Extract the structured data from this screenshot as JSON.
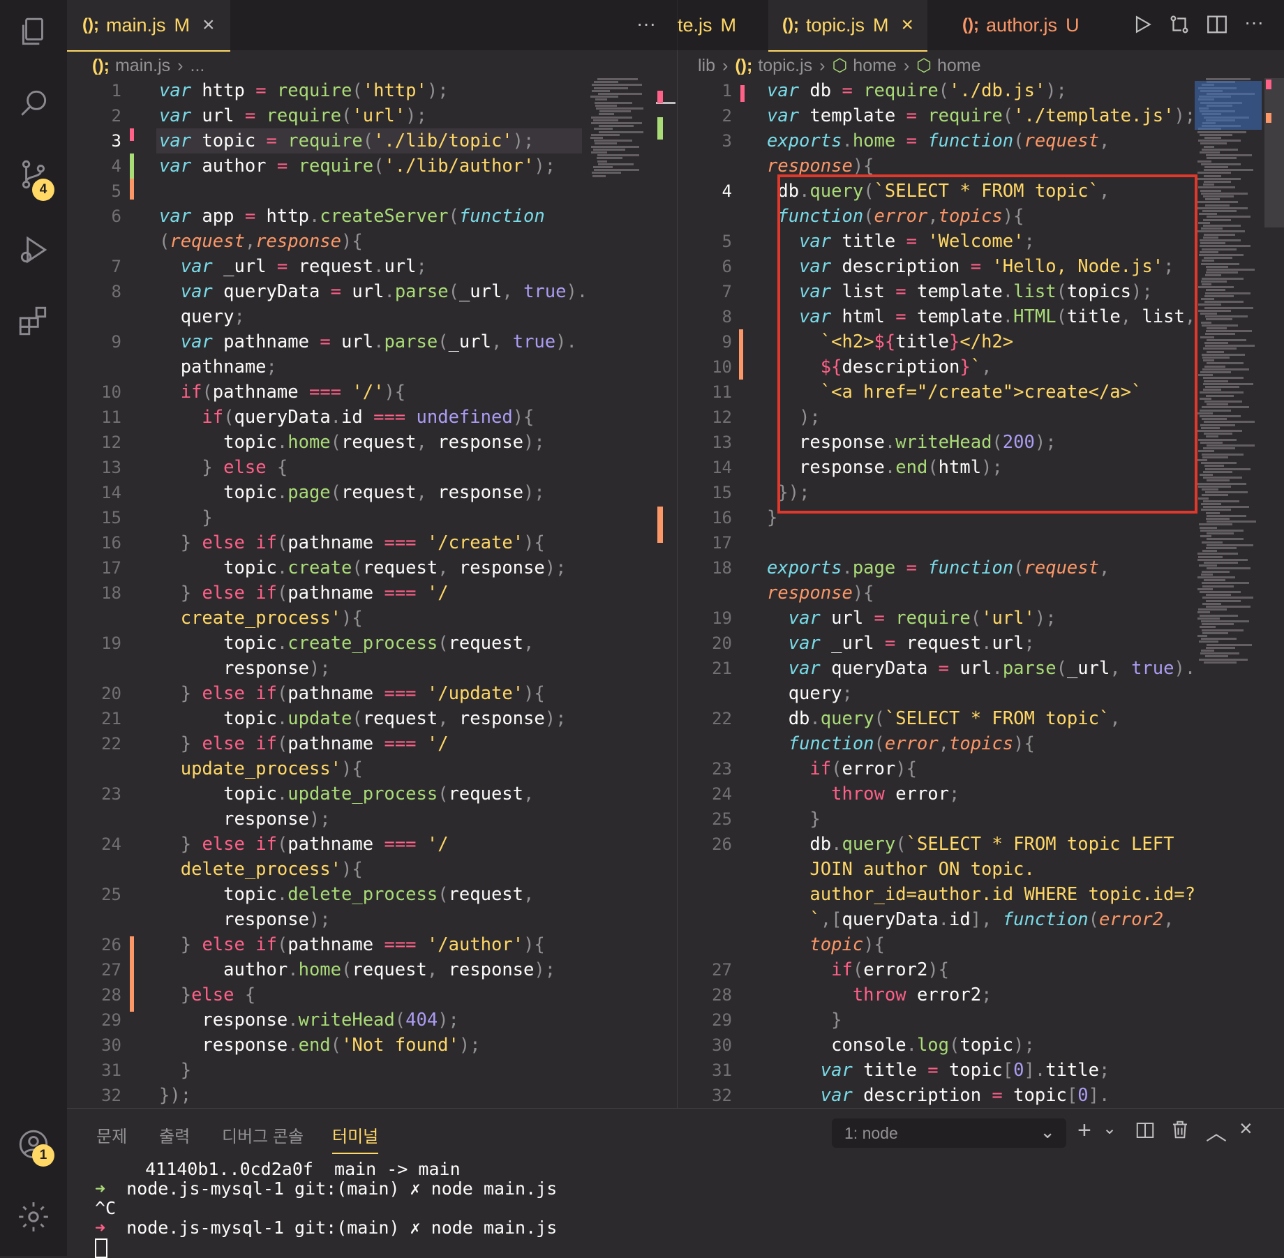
{
  "left_editor": {
    "tab": {
      "label": "main.js",
      "status": "M",
      "icon": "(); "
    },
    "breadcrumb": [
      "main.js",
      "..."
    ],
    "lines": [
      {
        "n": "1",
        "html": "<span class='k'>var</span> http <span class='kw'>=</span> <span class='fn'>require</span><span class='p'>(</span><span class='s'>'http'</span><span class='p'>);</span>"
      },
      {
        "n": "2",
        "html": "<span class='k'>var</span> url <span class='kw'>=</span> <span class='fn'>require</span><span class='p'>(</span><span class='s'>'url'</span><span class='p'>);</span>"
      },
      {
        "n": "3",
        "html": "<span class='k'>var</span> topic <span class='kw'>=</span> <span class='fn'>require</span><span class='p'>(</span><span class='s'>'./lib/topic'</span><span class='p'>);</span>"
      },
      {
        "n": "4",
        "html": "<span class='k'>var</span> author <span class='kw'>=</span> <span class='fn'>require</span><span class='p'>(</span><span class='s'>'./lib/author'</span><span class='p'>);</span>"
      },
      {
        "n": "5",
        "html": ""
      },
      {
        "n": "6",
        "html": "<span class='k'>var</span> app <span class='kw'>=</span> http<span class='p'>.</span><span class='fn'>createServer</span><span class='p'>(</span><span class='k'>function</span>"
      },
      {
        "n": "",
        "html": "<span class='p'>(</span><span class='prm'>request</span><span class='p'>,</span><span class='prm'>response</span><span class='p'>){</span>"
      },
      {
        "n": "7",
        "html": "  <span class='k'>var</span> _url <span class='kw'>=</span> request<span class='p'>.</span>url<span class='p'>;</span>"
      },
      {
        "n": "8",
        "html": "  <span class='k'>var</span> queryData <span class='kw'>=</span> url<span class='p'>.</span><span class='fn'>parse</span><span class='p'>(</span>_url<span class='p'>,</span> <span class='nm'>true</span><span class='p'>).</span>"
      },
      {
        "n": "",
        "html": "  query<span class='p'>;</span>"
      },
      {
        "n": "9",
        "html": "  <span class='k'>var</span> pathname <span class='kw'>=</span> url<span class='p'>.</span><span class='fn'>parse</span><span class='p'>(</span>_url<span class='p'>,</span> <span class='nm'>true</span><span class='p'>).</span>"
      },
      {
        "n": "",
        "html": "  pathname<span class='p'>;</span>"
      },
      {
        "n": "10",
        "html": "  <span class='kw'>if</span><span class='p'>(</span>pathname <span class='kw'>===</span> <span class='s'>'/'</span><span class='p'>){</span>"
      },
      {
        "n": "11",
        "html": "    <span class='kw'>if</span><span class='p'>(</span>queryData<span class='p'>.</span>id <span class='kw'>===</span> <span class='nm'>undefined</span><span class='p'>){</span>"
      },
      {
        "n": "12",
        "html": "      topic<span class='p'>.</span><span class='fn'>home</span><span class='p'>(</span>request<span class='p'>,</span> response<span class='p'>);</span>"
      },
      {
        "n": "13",
        "html": "    <span class='p'>}</span> <span class='kw'>else</span> <span class='p'>{</span>"
      },
      {
        "n": "14",
        "html": "      topic<span class='p'>.</span><span class='fn'>page</span><span class='p'>(</span>request<span class='p'>,</span> response<span class='p'>);</span>"
      },
      {
        "n": "15",
        "html": "    <span class='p'>}</span>"
      },
      {
        "n": "16",
        "html": "  <span class='p'>}</span> <span class='kw'>else</span> <span class='kw'>if</span><span class='p'>(</span>pathname <span class='kw'>===</span> <span class='s'>'/create'</span><span class='p'>){</span>"
      },
      {
        "n": "17",
        "html": "      topic<span class='p'>.</span><span class='fn'>create</span><span class='p'>(</span>request<span class='p'>,</span> response<span class='p'>);</span>"
      },
      {
        "n": "18",
        "html": "  <span class='p'>}</span> <span class='kw'>else</span> <span class='kw'>if</span><span class='p'>(</span>pathname <span class='kw'>===</span> <span class='s'>'/</span>"
      },
      {
        "n": "",
        "html": "  <span class='s'>create_process'</span><span class='p'>){</span>"
      },
      {
        "n": "19",
        "html": "      topic<span class='p'>.</span><span class='fn'>create_process</span><span class='p'>(</span>request<span class='p'>,</span>"
      },
      {
        "n": "",
        "html": "      response<span class='p'>);</span>"
      },
      {
        "n": "20",
        "html": "  <span class='p'>}</span> <span class='kw'>else</span> <span class='kw'>if</span><span class='p'>(</span>pathname <span class='kw'>===</span> <span class='s'>'/update'</span><span class='p'>){</span>"
      },
      {
        "n": "21",
        "html": "      topic<span class='p'>.</span><span class='fn'>update</span><span class='p'>(</span>request<span class='p'>,</span> response<span class='p'>);</span>"
      },
      {
        "n": "22",
        "html": "  <span class='p'>}</span> <span class='kw'>else</span> <span class='kw'>if</span><span class='p'>(</span>pathname <span class='kw'>===</span> <span class='s'>'/</span>"
      },
      {
        "n": "",
        "html": "  <span class='s'>update_process'</span><span class='p'>){</span>"
      },
      {
        "n": "23",
        "html": "      topic<span class='p'>.</span><span class='fn'>update_process</span><span class='p'>(</span>request<span class='p'>,</span>"
      },
      {
        "n": "",
        "html": "      response<span class='p'>);</span>"
      },
      {
        "n": "24",
        "html": "  <span class='p'>}</span> <span class='kw'>else</span> <span class='kw'>if</span><span class='p'>(</span>pathname <span class='kw'>===</span> <span class='s'>'/</span>"
      },
      {
        "n": "",
        "html": "  <span class='s'>delete_process'</span><span class='p'>){</span>"
      },
      {
        "n": "25",
        "html": "      topic<span class='p'>.</span><span class='fn'>delete_process</span><span class='p'>(</span>request<span class='p'>,</span>"
      },
      {
        "n": "",
        "html": "      response<span class='p'>);</span>"
      },
      {
        "n": "26",
        "html": "  <span class='p'>}</span> <span class='kw'>else</span> <span class='kw'>if</span><span class='p'>(</span>pathname <span class='kw'>===</span> <span class='s'>'/author'</span><span class='p'>){</span>"
      },
      {
        "n": "27",
        "html": "      author<span class='p'>.</span><span class='fn'>home</span><span class='p'>(</span>request<span class='p'>,</span> response<span class='p'>);</span>"
      },
      {
        "n": "28",
        "html": "  <span class='p'>}</span><span class='kw'>else</span> <span class='p'>{</span>"
      },
      {
        "n": "29",
        "html": "    response<span class='p'>.</span><span class='fn'>writeHead</span><span class='p'>(</span><span class='nm'>404</span><span class='p'>);</span>"
      },
      {
        "n": "30",
        "html": "    response<span class='p'>.</span><span class='fn'>end</span><span class='p'>(</span><span class='s'>'Not found'</span><span class='p'>);</span>"
      },
      {
        "n": "31",
        "html": "  <span class='p'>}</span>"
      },
      {
        "n": "32",
        "html": "<span class='p'>});</span>"
      }
    ]
  },
  "right_editor": {
    "tabs": [
      {
        "label": "te.js",
        "status": "M"
      },
      {
        "label": "topic.js",
        "status": "M",
        "icon": "(); ",
        "active": true
      },
      {
        "label": "author.js",
        "status": "U",
        "icon": "(); "
      }
    ],
    "breadcrumb": [
      "lib",
      "topic.js",
      "home",
      "home"
    ],
    "lines": [
      {
        "n": "1",
        "html": "<span class='k'>var</span> db <span class='kw'>=</span> <span class='fn'>require</span><span class='p'>(</span><span class='s'>'./db.js'</span><span class='p'>);</span>"
      },
      {
        "n": "2",
        "html": "<span class='k'>var</span> template <span class='kw'>=</span> <span class='fn'>require</span><span class='p'>(</span><span class='s'>'./template.js'</span><span class='p'>);</span>"
      },
      {
        "n": "3",
        "html": "<span class='k'>exports</span><span class='p'>.</span><span class='fn'>home</span> <span class='kw'>=</span> <span class='k'>function</span><span class='p'>(</span><span class='prm'>request</span><span class='p'>,</span>"
      },
      {
        "n": "",
        "html": "<span class='prm'>response</span><span class='p'>){</span>"
      },
      {
        "n": "4",
        "html": " db<span class='p'>.</span><span class='fn'>query</span><span class='p'>(</span><span class='s'>`SELECT * FROM topic`</span><span class='p'>,</span>"
      },
      {
        "n": "",
        "html": " <span class='k'>function</span><span class='p'>(</span><span class='prm'>error</span><span class='p'>,</span><span class='prm'>topics</span><span class='p'>){</span>"
      },
      {
        "n": "5",
        "html": "   <span class='k'>var</span> title <span class='kw'>=</span> <span class='s'>'Welcome'</span><span class='p'>;</span>"
      },
      {
        "n": "6",
        "html": "   <span class='k'>var</span> description <span class='kw'>=</span> <span class='s'>'Hello, Node.js'</span><span class='p'>;</span>"
      },
      {
        "n": "7",
        "html": "   <span class='k'>var</span> list <span class='kw'>=</span> template<span class='p'>.</span><span class='fn'>list</span><span class='p'>(</span>topics<span class='p'>);</span>"
      },
      {
        "n": "8",
        "html": "   <span class='k'>var</span> html <span class='kw'>=</span> template<span class='p'>.</span><span class='fn'>HTML</span><span class='p'>(</span>title<span class='p'>,</span> list<span class='p'>,</span>"
      },
      {
        "n": "9",
        "html": "     <span class='s'>`&lt;h2&gt;</span><span class='kw'>${</span>title<span class='kw'>}</span><span class='s'>&lt;/h2&gt;</span>"
      },
      {
        "n": "10",
        "html": "     <span class='kw'>${</span>description<span class='kw'>}</span><span class='s'>`</span><span class='p'>,</span>"
      },
      {
        "n": "11",
        "html": "     <span class='s'>`&lt;a href=\"/create\"&gt;create&lt;/a&gt;`</span>"
      },
      {
        "n": "12",
        "html": "   <span class='p'>);</span>"
      },
      {
        "n": "13",
        "html": "   response<span class='p'>.</span><span class='fn'>writeHead</span><span class='p'>(</span><span class='nm'>200</span><span class='p'>);</span>"
      },
      {
        "n": "14",
        "html": "   response<span class='p'>.</span><span class='fn'>end</span><span class='p'>(</span>html<span class='p'>);</span>"
      },
      {
        "n": "15",
        "html": " <span class='p'>});</span>"
      },
      {
        "n": "16",
        "html": "<span class='p'>}</span>"
      },
      {
        "n": "17",
        "html": ""
      },
      {
        "n": "18",
        "html": "<span class='k'>exports</span><span class='p'>.</span><span class='fn'>page</span> <span class='kw'>=</span> <span class='k'>function</span><span class='p'>(</span><span class='prm'>request</span><span class='p'>,</span>"
      },
      {
        "n": "",
        "html": "<span class='prm'>response</span><span class='p'>){</span>"
      },
      {
        "n": "19",
        "html": "  <span class='k'>var</span> url <span class='kw'>=</span> <span class='fn'>require</span><span class='p'>(</span><span class='s'>'url'</span><span class='p'>);</span>"
      },
      {
        "n": "20",
        "html": "  <span class='k'>var</span> _url <span class='kw'>=</span> request<span class='p'>.</span>url<span class='p'>;</span>"
      },
      {
        "n": "21",
        "html": "  <span class='k'>var</span> queryData <span class='kw'>=</span> url<span class='p'>.</span><span class='fn'>parse</span><span class='p'>(</span>_url<span class='p'>,</span> <span class='nm'>true</span><span class='p'>).</span>"
      },
      {
        "n": "",
        "html": "  query<span class='p'>;</span>"
      },
      {
        "n": "22",
        "html": "  db<span class='p'>.</span><span class='fn'>query</span><span class='p'>(</span><span class='s'>`SELECT * FROM topic`</span><span class='p'>,</span>"
      },
      {
        "n": "",
        "html": "  <span class='k'>function</span><span class='p'>(</span><span class='prm'>error</span><span class='p'>,</span><span class='prm'>topics</span><span class='p'>){</span>"
      },
      {
        "n": "23",
        "html": "    <span class='kw'>if</span><span class='p'>(</span>error<span class='p'>){</span>"
      },
      {
        "n": "24",
        "html": "      <span class='kw'>throw</span> error<span class='p'>;</span>"
      },
      {
        "n": "25",
        "html": "    <span class='p'>}</span>"
      },
      {
        "n": "26",
        "html": "    db<span class='p'>.</span><span class='fn'>query</span><span class='p'>(</span><span class='s'>`SELECT * FROM topic LEFT</span>"
      },
      {
        "n": "",
        "html": "    <span class='s'>JOIN author ON topic.</span>"
      },
      {
        "n": "",
        "html": "    <span class='s'>author_id=author.id WHERE topic.id=?</span>"
      },
      {
        "n": "",
        "html": "    <span class='s'>`</span><span class='p'>,[</span>queryData<span class='p'>.</span>id<span class='p'>],</span> <span class='k'>function</span><span class='p'>(</span><span class='prm'>error2</span><span class='p'>,</span>"
      },
      {
        "n": "",
        "html": "    <span class='prm'>topic</span><span class='p'>){</span>"
      },
      {
        "n": "27",
        "html": "      <span class='kw'>if</span><span class='p'>(</span>error2<span class='p'>){</span>"
      },
      {
        "n": "28",
        "html": "        <span class='kw'>throw</span> error2<span class='p'>;</span>"
      },
      {
        "n": "29",
        "html": "      <span class='p'>}</span>"
      },
      {
        "n": "30",
        "html": "      console<span class='p'>.</span><span class='fn'>log</span><span class='p'>(</span>topic<span class='p'>);</span>"
      },
      {
        "n": "31",
        "html": "     <span class='k'>var</span> title <span class='kw'>=</span> topic<span class='p'>[</span><span class='nm'>0</span><span class='p'>].</span>title<span class='p'>;</span>"
      },
      {
        "n": "32",
        "html": "     <span class='k'>var</span> description <span class='kw'>=</span> topic<span class='p'>[</span><span class='nm'>0</span><span class='p'>].</span>"
      }
    ]
  },
  "panel": {
    "tabs": [
      "문제",
      "출력",
      "디버그 콘솔",
      "터미널"
    ],
    "terminal_select": "1: node",
    "terminal_lines": [
      "  41140b1..0cd2a0f  main -> main",
      "node.js-mysql-1 git:(main) ✗ node main.js",
      "^C",
      "node.js-mysql-1 git:(main) ✗ node main.js"
    ]
  },
  "activity": {
    "scm_badge": "4",
    "account_badge": "1"
  },
  "colors": {
    "accent": "#ffd866",
    "highlight": "#e0392b",
    "bg": "#2d2a2e"
  }
}
